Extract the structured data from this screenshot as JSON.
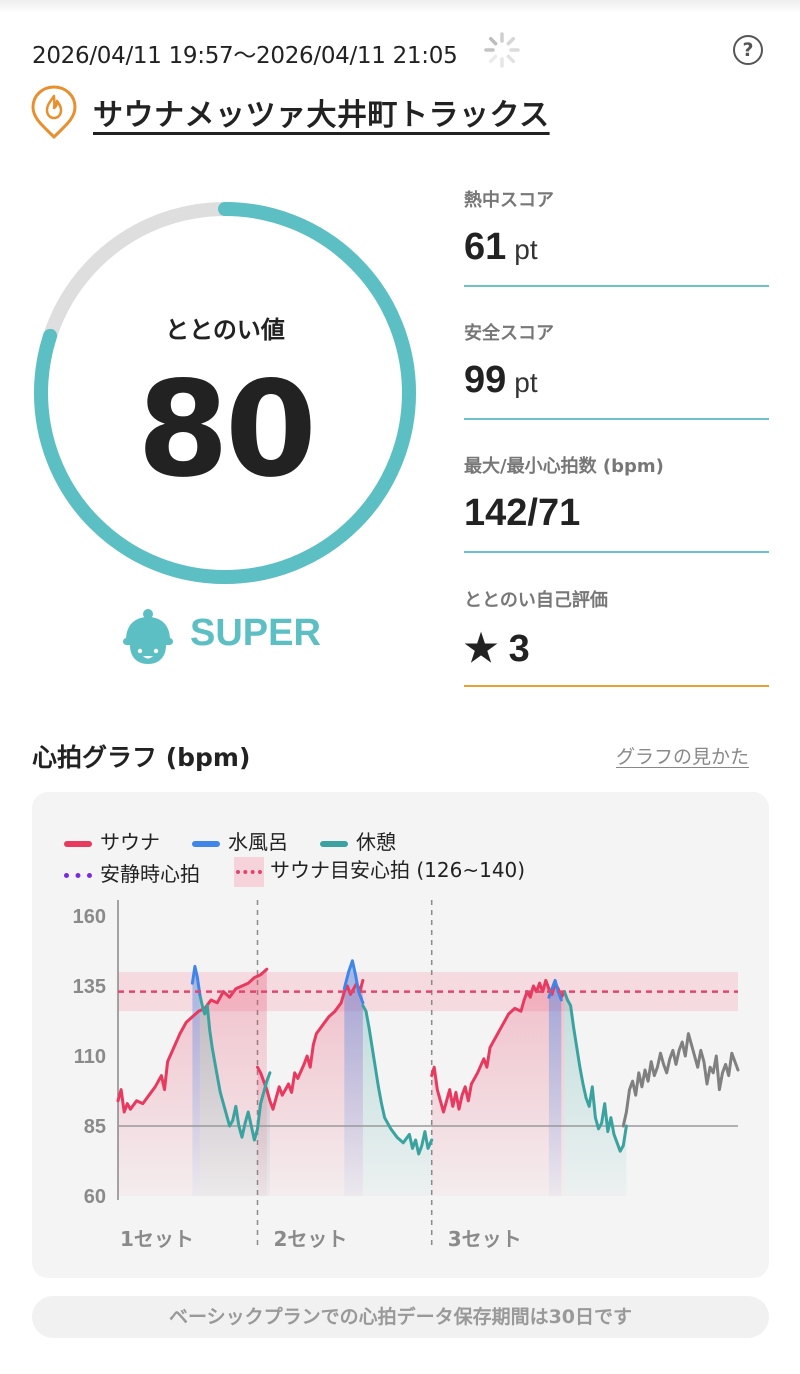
{
  "header": {
    "datetime": "2026/04/11 19:57～2026/04/11 21:05",
    "help": "?",
    "facility": "サウナメッツァ大井町トラックス"
  },
  "score": {
    "label": "ととのい値",
    "value": "80",
    "progress": 0.8,
    "grade": "SUPER",
    "accent": "#5bbfc3"
  },
  "metrics": [
    {
      "label": "熱中スコア",
      "value": "61",
      "unit": "pt",
      "line_color": "#6ec1c9"
    },
    {
      "label": "安全スコア",
      "value": "99",
      "unit": "pt",
      "line_color": "#6ec1c9"
    },
    {
      "label": "最大/最小心拍数 (bpm)",
      "value": "142/71",
      "unit": "",
      "line_color": "#6ec1c9"
    },
    {
      "label": "ととのい自己評価",
      "value": "★ 3",
      "unit": "",
      "line_color": "#e8a030"
    }
  ],
  "chart_section": {
    "title": "心拍グラフ (bpm)",
    "howto": "グラフの見かた"
  },
  "chart_data": {
    "type": "line",
    "legend": {
      "sauna": "サウナ",
      "cold": "水風呂",
      "rest": "休憩",
      "resting_hr": "安静時心拍",
      "target": "サウナ目安心拍 (126~140)"
    },
    "colors": {
      "sauna": "#e8395f",
      "cold": "#3f86e8",
      "rest": "#3aa39f",
      "other": "#808080",
      "resting_hr": "#7a2be0",
      "target_line": "#e0476d",
      "target_band": "#f6d2da"
    },
    "yticks": [
      "160",
      "135",
      "110",
      "85",
      "60"
    ],
    "ylim": [
      60,
      160
    ],
    "resting_hr": 85,
    "target_range": [
      126,
      140
    ],
    "target_line": 133,
    "sets": [
      "1セット",
      "2セット",
      "3セット"
    ],
    "x_range": [
      0,
      100
    ],
    "set_boundaries": [
      22.5,
      50.6
    ],
    "segments": [
      {
        "type": "sauna",
        "points": [
          [
            0,
            94
          ],
          [
            0.5,
            98
          ],
          [
            1,
            90
          ],
          [
            1.5,
            93
          ],
          [
            2,
            91
          ],
          [
            3,
            94
          ],
          [
            4,
            93
          ],
          [
            5,
            96
          ],
          [
            6,
            99
          ],
          [
            7,
            103
          ],
          [
            7.5,
            98
          ],
          [
            8,
            108
          ],
          [
            9,
            113
          ],
          [
            10,
            118
          ],
          [
            11,
            122
          ],
          [
            12,
            124
          ],
          [
            13,
            126
          ],
          [
            14,
            127
          ],
          [
            15,
            130
          ],
          [
            16,
            129
          ],
          [
            17,
            133
          ],
          [
            18,
            131
          ],
          [
            19,
            134
          ],
          [
            20,
            135
          ],
          [
            21,
            136
          ],
          [
            22,
            138
          ],
          [
            23,
            139
          ],
          [
            24,
            141
          ]
        ]
      },
      {
        "type": "cold",
        "points": [
          [
            12,
            136
          ],
          [
            12.4,
            142
          ],
          [
            12.8,
            138
          ],
          [
            13.2,
            132
          ]
        ]
      },
      {
        "type": "rest",
        "points": [
          [
            13.2,
            132
          ],
          [
            13.7,
            127
          ],
          [
            14,
            125
          ],
          [
            14.4,
            128
          ],
          [
            14.8,
            119
          ],
          [
            15.2,
            113
          ],
          [
            15.6,
            108
          ],
          [
            16,
            103
          ],
          [
            16.5,
            97
          ],
          [
            17,
            93
          ],
          [
            17.5,
            89
          ],
          [
            18,
            85
          ],
          [
            18.5,
            87
          ],
          [
            19,
            92
          ],
          [
            19.5,
            85
          ],
          [
            20,
            81
          ],
          [
            20.5,
            86
          ],
          [
            21,
            90
          ],
          [
            21.5,
            85
          ],
          [
            22,
            80
          ],
          [
            22.5,
            84
          ],
          [
            23,
            93
          ],
          [
            23.5,
            97
          ],
          [
            24,
            101
          ],
          [
            24.5,
            104
          ]
        ]
      },
      {
        "type": "sauna",
        "points": [
          [
            22.5,
            106
          ],
          [
            23,
            104
          ],
          [
            23.5,
            101
          ],
          [
            24,
            98
          ],
          [
            24.5,
            94
          ],
          [
            25,
            91
          ],
          [
            25.5,
            95
          ],
          [
            26,
            99
          ],
          [
            26.5,
            96
          ],
          [
            27,
            98
          ],
          [
            27.5,
            100
          ],
          [
            28,
            97
          ],
          [
            28.5,
            104
          ],
          [
            29,
            102
          ],
          [
            30,
            107
          ],
          [
            30.5,
            110
          ],
          [
            31,
            106
          ],
          [
            31.5,
            114
          ],
          [
            32,
            118
          ],
          [
            33,
            121
          ],
          [
            34,
            124
          ],
          [
            35,
            126
          ],
          [
            36,
            129
          ],
          [
            36.5,
            133
          ],
          [
            37,
            135
          ],
          [
            37.5,
            132
          ],
          [
            38,
            134
          ],
          [
            38.5,
            136
          ],
          [
            39,
            133
          ],
          [
            39.5,
            137
          ]
        ]
      },
      {
        "type": "cold",
        "points": [
          [
            36.5,
            134
          ],
          [
            37.2,
            140
          ],
          [
            37.8,
            144
          ],
          [
            38.3,
            139
          ],
          [
            38.8,
            133
          ],
          [
            39.5,
            129
          ]
        ]
      },
      {
        "type": "rest",
        "points": [
          [
            39.5,
            128
          ],
          [
            40,
            126
          ],
          [
            40.5,
            120
          ],
          [
            41,
            113
          ],
          [
            41.5,
            106
          ],
          [
            42,
            99
          ],
          [
            42.5,
            93
          ],
          [
            43,
            88
          ],
          [
            44,
            84
          ],
          [
            45,
            81
          ],
          [
            46,
            79
          ],
          [
            47,
            82
          ],
          [
            47.5,
            77
          ],
          [
            48,
            80
          ],
          [
            48.5,
            75
          ],
          [
            49,
            78
          ],
          [
            49.5,
            83
          ],
          [
            50,
            77
          ],
          [
            50.6,
            80
          ]
        ]
      },
      {
        "type": "sauna",
        "points": [
          [
            50.6,
            103
          ],
          [
            51,
            106
          ],
          [
            51.5,
            98
          ],
          [
            52,
            94
          ],
          [
            52.5,
            90
          ],
          [
            53,
            94
          ],
          [
            53.5,
            98
          ],
          [
            54,
            92
          ],
          [
            54.5,
            97
          ],
          [
            55,
            91
          ],
          [
            55.5,
            96
          ],
          [
            56,
            99
          ],
          [
            56.5,
            94
          ],
          [
            57,
            100
          ],
          [
            58,
            104
          ],
          [
            59,
            109
          ],
          [
            59.5,
            106
          ],
          [
            60,
            113
          ],
          [
            61,
            117
          ],
          [
            62,
            121
          ],
          [
            63,
            125
          ],
          [
            64,
            127
          ],
          [
            65,
            126
          ],
          [
            65.5,
            130
          ],
          [
            66,
            133
          ],
          [
            66.5,
            131
          ],
          [
            67,
            135
          ],
          [
            67.5,
            133
          ],
          [
            68,
            136
          ],
          [
            68.5,
            133
          ],
          [
            69,
            137
          ],
          [
            69.5,
            134
          ],
          [
            70,
            132
          ],
          [
            70.5,
            136
          ],
          [
            71,
            134
          ],
          [
            71.5,
            131
          ],
          [
            72,
            133
          ]
        ]
      },
      {
        "type": "cold",
        "points": [
          [
            69.5,
            131
          ],
          [
            70,
            134
          ],
          [
            70.5,
            137
          ],
          [
            71,
            133
          ],
          [
            71.5,
            130
          ]
        ]
      },
      {
        "type": "rest",
        "points": [
          [
            72,
            133
          ],
          [
            72.5,
            130
          ],
          [
            73,
            128
          ],
          [
            73.5,
            120
          ],
          [
            74,
            113
          ],
          [
            74.5,
            106
          ],
          [
            75,
            100
          ],
          [
            75.5,
            95
          ],
          [
            76,
            92
          ],
          [
            76.5,
            99
          ],
          [
            77,
            88
          ],
          [
            77.5,
            84
          ],
          [
            78,
            86
          ],
          [
            78.5,
            93
          ],
          [
            79,
            83
          ],
          [
            79.5,
            88
          ],
          [
            80,
            82
          ],
          [
            80.5,
            79
          ],
          [
            81,
            76
          ],
          [
            81.5,
            78
          ],
          [
            82,
            85
          ]
        ]
      },
      {
        "type": "other",
        "points": [
          [
            81.5,
            85
          ],
          [
            82,
            90
          ],
          [
            82.5,
            98
          ],
          [
            83,
            101
          ],
          [
            83.5,
            96
          ],
          [
            84,
            104
          ],
          [
            84.5,
            99
          ],
          [
            85,
            105
          ],
          [
            85.5,
            101
          ],
          [
            86,
            108
          ],
          [
            86.5,
            103
          ],
          [
            87,
            106
          ],
          [
            87.5,
            111
          ],
          [
            88,
            107
          ],
          [
            88.5,
            104
          ],
          [
            89,
            109
          ],
          [
            89.5,
            112
          ],
          [
            90,
            107
          ],
          [
            90.5,
            112
          ],
          [
            91,
            115
          ],
          [
            91.5,
            110
          ],
          [
            92,
            118
          ],
          [
            92.5,
            114
          ],
          [
            93,
            110
          ],
          [
            93.5,
            106
          ],
          [
            94,
            112
          ],
          [
            94.5,
            108
          ],
          [
            95,
            100
          ],
          [
            95.5,
            106
          ],
          [
            96,
            104
          ],
          [
            96.5,
            110
          ],
          [
            97,
            98
          ],
          [
            97.5,
            104
          ],
          [
            98,
            107
          ],
          [
            98.5,
            103
          ],
          [
            99,
            111
          ],
          [
            99.5,
            108
          ],
          [
            100,
            105
          ]
        ]
      }
    ]
  },
  "notice": "ベーシックプランでの心拍データ保存期間は30日です"
}
